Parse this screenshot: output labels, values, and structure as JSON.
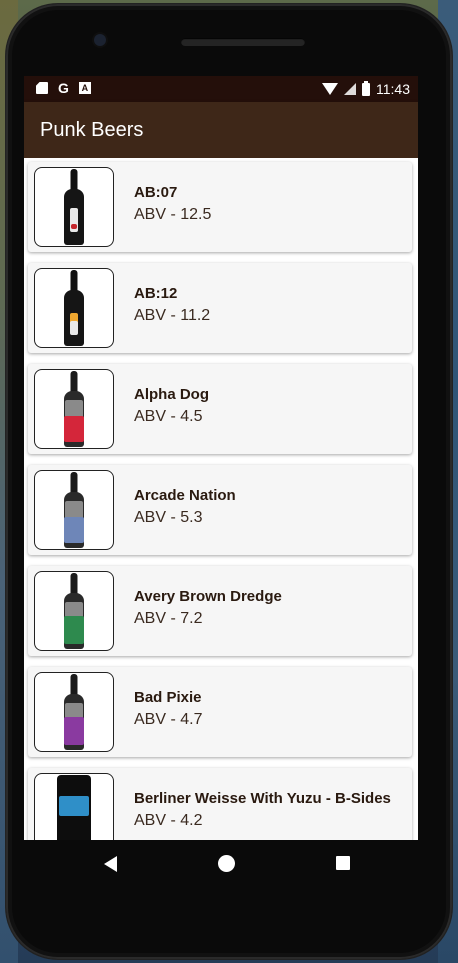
{
  "status_bar": {
    "time": "11:43",
    "left_icons": [
      "sd-card-icon",
      "google-icon",
      "a-icon"
    ],
    "right_icons": [
      "wifi-icon",
      "signal-icon",
      "battery-charging-icon"
    ],
    "g_letter": "G",
    "a_letter": "A"
  },
  "app_bar": {
    "title": "Punk Beers",
    "color": "#3e2718"
  },
  "beers": [
    {
      "name": "AB:07",
      "abv": "ABV - 12.5"
    },
    {
      "name": "AB:12",
      "abv": "ABV - 11.2"
    },
    {
      "name": "Alpha Dog",
      "abv": "ABV - 4.5"
    },
    {
      "name": "Arcade Nation",
      "abv": "ABV - 5.3"
    },
    {
      "name": "Avery Brown Dredge",
      "abv": "ABV - 7.2"
    },
    {
      "name": "Bad Pixie",
      "abv": "ABV - 4.7"
    },
    {
      "name": "Berliner Weisse With Yuzu - B-Sides",
      "abv": "ABV - 4.2"
    }
  ],
  "nav_bar": {
    "buttons": [
      "back-icon",
      "home-icon",
      "recents-icon"
    ]
  }
}
